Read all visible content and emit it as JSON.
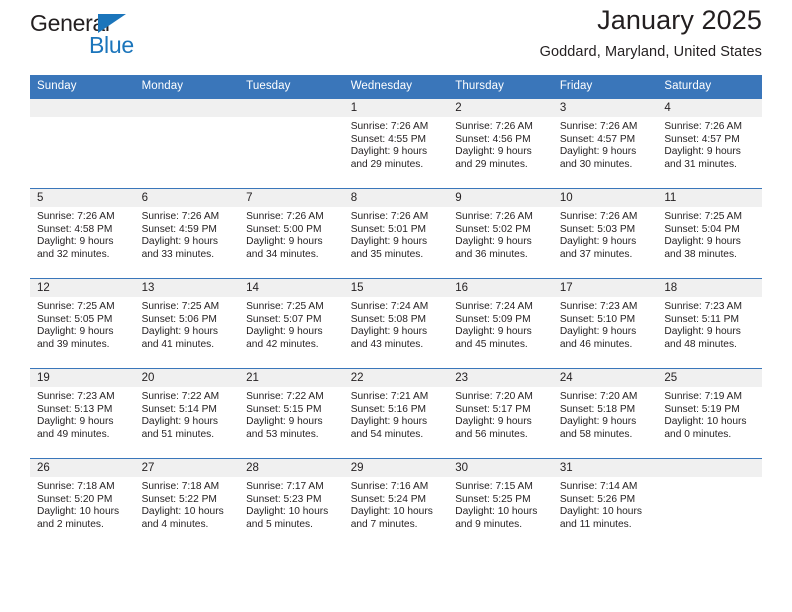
{
  "brand": {
    "name_part1": "General",
    "name_part2": "Blue",
    "accent_color": "#1b75bb"
  },
  "header": {
    "title": "January 2025",
    "subtitle": "Goddard, Maryland, United States",
    "header_bg_color": "#3a76ba",
    "datestrip_bg_color": "#f0f0f0"
  },
  "weekdays": [
    "Sunday",
    "Monday",
    "Tuesday",
    "Wednesday",
    "Thursday",
    "Friday",
    "Saturday"
  ],
  "labels": {
    "sunrise": "Sunrise:",
    "sunset": "Sunset:",
    "daylight": "Daylight:"
  },
  "weeks": [
    [
      {
        "date": "",
        "empty": true
      },
      {
        "date": "",
        "empty": true
      },
      {
        "date": "",
        "empty": true
      },
      {
        "date": "1",
        "sunrise": "Sunrise: 7:26 AM",
        "sunset": "Sunset: 4:55 PM",
        "daylight_line1": "Daylight: 9 hours",
        "daylight_line2": "and 29 minutes."
      },
      {
        "date": "2",
        "sunrise": "Sunrise: 7:26 AM",
        "sunset": "Sunset: 4:56 PM",
        "daylight_line1": "Daylight: 9 hours",
        "daylight_line2": "and 29 minutes."
      },
      {
        "date": "3",
        "sunrise": "Sunrise: 7:26 AM",
        "sunset": "Sunset: 4:57 PM",
        "daylight_line1": "Daylight: 9 hours",
        "daylight_line2": "and 30 minutes."
      },
      {
        "date": "4",
        "sunrise": "Sunrise: 7:26 AM",
        "sunset": "Sunset: 4:57 PM",
        "daylight_line1": "Daylight: 9 hours",
        "daylight_line2": "and 31 minutes."
      }
    ],
    [
      {
        "date": "5",
        "sunrise": "Sunrise: 7:26 AM",
        "sunset": "Sunset: 4:58 PM",
        "daylight_line1": "Daylight: 9 hours",
        "daylight_line2": "and 32 minutes."
      },
      {
        "date": "6",
        "sunrise": "Sunrise: 7:26 AM",
        "sunset": "Sunset: 4:59 PM",
        "daylight_line1": "Daylight: 9 hours",
        "daylight_line2": "and 33 minutes."
      },
      {
        "date": "7",
        "sunrise": "Sunrise: 7:26 AM",
        "sunset": "Sunset: 5:00 PM",
        "daylight_line1": "Daylight: 9 hours",
        "daylight_line2": "and 34 minutes."
      },
      {
        "date": "8",
        "sunrise": "Sunrise: 7:26 AM",
        "sunset": "Sunset: 5:01 PM",
        "daylight_line1": "Daylight: 9 hours",
        "daylight_line2": "and 35 minutes."
      },
      {
        "date": "9",
        "sunrise": "Sunrise: 7:26 AM",
        "sunset": "Sunset: 5:02 PM",
        "daylight_line1": "Daylight: 9 hours",
        "daylight_line2": "and 36 minutes."
      },
      {
        "date": "10",
        "sunrise": "Sunrise: 7:26 AM",
        "sunset": "Sunset: 5:03 PM",
        "daylight_line1": "Daylight: 9 hours",
        "daylight_line2": "and 37 minutes."
      },
      {
        "date": "11",
        "sunrise": "Sunrise: 7:25 AM",
        "sunset": "Sunset: 5:04 PM",
        "daylight_line1": "Daylight: 9 hours",
        "daylight_line2": "and 38 minutes."
      }
    ],
    [
      {
        "date": "12",
        "sunrise": "Sunrise: 7:25 AM",
        "sunset": "Sunset: 5:05 PM",
        "daylight_line1": "Daylight: 9 hours",
        "daylight_line2": "and 39 minutes."
      },
      {
        "date": "13",
        "sunrise": "Sunrise: 7:25 AM",
        "sunset": "Sunset: 5:06 PM",
        "daylight_line1": "Daylight: 9 hours",
        "daylight_line2": "and 41 minutes."
      },
      {
        "date": "14",
        "sunrise": "Sunrise: 7:25 AM",
        "sunset": "Sunset: 5:07 PM",
        "daylight_line1": "Daylight: 9 hours",
        "daylight_line2": "and 42 minutes."
      },
      {
        "date": "15",
        "sunrise": "Sunrise: 7:24 AM",
        "sunset": "Sunset: 5:08 PM",
        "daylight_line1": "Daylight: 9 hours",
        "daylight_line2": "and 43 minutes."
      },
      {
        "date": "16",
        "sunrise": "Sunrise: 7:24 AM",
        "sunset": "Sunset: 5:09 PM",
        "daylight_line1": "Daylight: 9 hours",
        "daylight_line2": "and 45 minutes."
      },
      {
        "date": "17",
        "sunrise": "Sunrise: 7:23 AM",
        "sunset": "Sunset: 5:10 PM",
        "daylight_line1": "Daylight: 9 hours",
        "daylight_line2": "and 46 minutes."
      },
      {
        "date": "18",
        "sunrise": "Sunrise: 7:23 AM",
        "sunset": "Sunset: 5:11 PM",
        "daylight_line1": "Daylight: 9 hours",
        "daylight_line2": "and 48 minutes."
      }
    ],
    [
      {
        "date": "19",
        "sunrise": "Sunrise: 7:23 AM",
        "sunset": "Sunset: 5:13 PM",
        "daylight_line1": "Daylight: 9 hours",
        "daylight_line2": "and 49 minutes."
      },
      {
        "date": "20",
        "sunrise": "Sunrise: 7:22 AM",
        "sunset": "Sunset: 5:14 PM",
        "daylight_line1": "Daylight: 9 hours",
        "daylight_line2": "and 51 minutes."
      },
      {
        "date": "21",
        "sunrise": "Sunrise: 7:22 AM",
        "sunset": "Sunset: 5:15 PM",
        "daylight_line1": "Daylight: 9 hours",
        "daylight_line2": "and 53 minutes."
      },
      {
        "date": "22",
        "sunrise": "Sunrise: 7:21 AM",
        "sunset": "Sunset: 5:16 PM",
        "daylight_line1": "Daylight: 9 hours",
        "daylight_line2": "and 54 minutes."
      },
      {
        "date": "23",
        "sunrise": "Sunrise: 7:20 AM",
        "sunset": "Sunset: 5:17 PM",
        "daylight_line1": "Daylight: 9 hours",
        "daylight_line2": "and 56 minutes."
      },
      {
        "date": "24",
        "sunrise": "Sunrise: 7:20 AM",
        "sunset": "Sunset: 5:18 PM",
        "daylight_line1": "Daylight: 9 hours",
        "daylight_line2": "and 58 minutes."
      },
      {
        "date": "25",
        "sunrise": "Sunrise: 7:19 AM",
        "sunset": "Sunset: 5:19 PM",
        "daylight_line1": "Daylight: 10 hours",
        "daylight_line2": "and 0 minutes."
      }
    ],
    [
      {
        "date": "26",
        "sunrise": "Sunrise: 7:18 AM",
        "sunset": "Sunset: 5:20 PM",
        "daylight_line1": "Daylight: 10 hours",
        "daylight_line2": "and 2 minutes."
      },
      {
        "date": "27",
        "sunrise": "Sunrise: 7:18 AM",
        "sunset": "Sunset: 5:22 PM",
        "daylight_line1": "Daylight: 10 hours",
        "daylight_line2": "and 4 minutes."
      },
      {
        "date": "28",
        "sunrise": "Sunrise: 7:17 AM",
        "sunset": "Sunset: 5:23 PM",
        "daylight_line1": "Daylight: 10 hours",
        "daylight_line2": "and 5 minutes."
      },
      {
        "date": "29",
        "sunrise": "Sunrise: 7:16 AM",
        "sunset": "Sunset: 5:24 PM",
        "daylight_line1": "Daylight: 10 hours",
        "daylight_line2": "and 7 minutes."
      },
      {
        "date": "30",
        "sunrise": "Sunrise: 7:15 AM",
        "sunset": "Sunset: 5:25 PM",
        "daylight_line1": "Daylight: 10 hours",
        "daylight_line2": "and 9 minutes."
      },
      {
        "date": "31",
        "sunrise": "Sunrise: 7:14 AM",
        "sunset": "Sunset: 5:26 PM",
        "daylight_line1": "Daylight: 10 hours",
        "daylight_line2": "and 11 minutes."
      },
      {
        "date": "",
        "empty": true
      }
    ]
  ]
}
